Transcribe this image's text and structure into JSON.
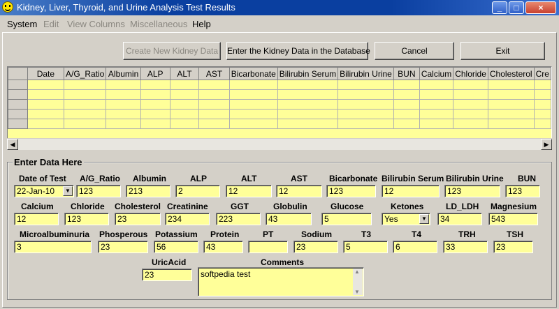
{
  "window": {
    "title": "Kidney, Liver, Thyroid, and Urine Analysis Test Results",
    "minimize": "_",
    "maximize": "□",
    "close": "×"
  },
  "menu": {
    "system": "System",
    "edit": "Edit",
    "view_columns": "View Columns",
    "miscellaneous": "Miscellaneous",
    "help": "Help"
  },
  "toolbar": {
    "create_new": "Create New Kidney Data",
    "enter_data": "Enter the Kidney Data in the Database",
    "cancel": "Cancel",
    "exit": "Exit"
  },
  "grid": {
    "columns": [
      "Date",
      "A/G_Ratio",
      "Albumin",
      "ALP",
      "ALT",
      "AST",
      "Bicarbonate",
      "Bilirubin Serum",
      "Bilirubin Urine",
      "BUN",
      "Calcium",
      "Chloride",
      "Cholesterol",
      "Cre"
    ]
  },
  "form": {
    "title": "Enter Data Here",
    "date_of_test": {
      "label": "Date of Test",
      "value": "22-Jan-10"
    },
    "ag_ratio": {
      "label": "A/G_Ratio",
      "value": "123"
    },
    "albumin": {
      "label": "Albumin",
      "value": "213"
    },
    "alp": {
      "label": "ALP",
      "value": "2"
    },
    "alt": {
      "label": "ALT",
      "value": "12"
    },
    "ast": {
      "label": "AST",
      "value": "12"
    },
    "bicarbonate": {
      "label": "Bicarbonate",
      "value": "123"
    },
    "bilirubin_serum": {
      "label": "Bilirubin Serum",
      "value": "12"
    },
    "bilirubin_urine": {
      "label": "Bilirubin Urine",
      "value": "123"
    },
    "bun": {
      "label": "BUN",
      "value": "123"
    },
    "calcium": {
      "label": "Calcium",
      "value": "12"
    },
    "chloride": {
      "label": "Chloride",
      "value": "123"
    },
    "cholesterol": {
      "label": "Cholesterol",
      "value": "23"
    },
    "creatinine": {
      "label": "Creatinine",
      "value": "234"
    },
    "ggt": {
      "label": "GGT",
      "value": "223"
    },
    "globulin": {
      "label": "Globulin",
      "value": "43"
    },
    "glucose": {
      "label": "Glucose",
      "value": "5"
    },
    "ketones": {
      "label": "Ketones",
      "value": "Yes"
    },
    "ld_ldh": {
      "label": "LD_LDH",
      "value": "34"
    },
    "magnesium": {
      "label": "Magnesium",
      "value": "543"
    },
    "microalbuminuria": {
      "label": "Microalbuminuria",
      "value": "3"
    },
    "phosperous": {
      "label": "Phosperous",
      "value": "23"
    },
    "potassium": {
      "label": "Potassium",
      "value": "56"
    },
    "protein": {
      "label": "Protein",
      "value": "43"
    },
    "pt": {
      "label": "PT",
      "value": ""
    },
    "sodium": {
      "label": "Sodium",
      "value": "23"
    },
    "t3": {
      "label": "T3",
      "value": "5"
    },
    "t4": {
      "label": "T4",
      "value": "6"
    },
    "trh": {
      "label": "TRH",
      "value": "33"
    },
    "tsh": {
      "label": "TSH",
      "value": "23"
    },
    "uricacid": {
      "label": "UricAcid",
      "value": "23"
    },
    "comments": {
      "label": "Comments",
      "value": "softpedia test"
    }
  }
}
